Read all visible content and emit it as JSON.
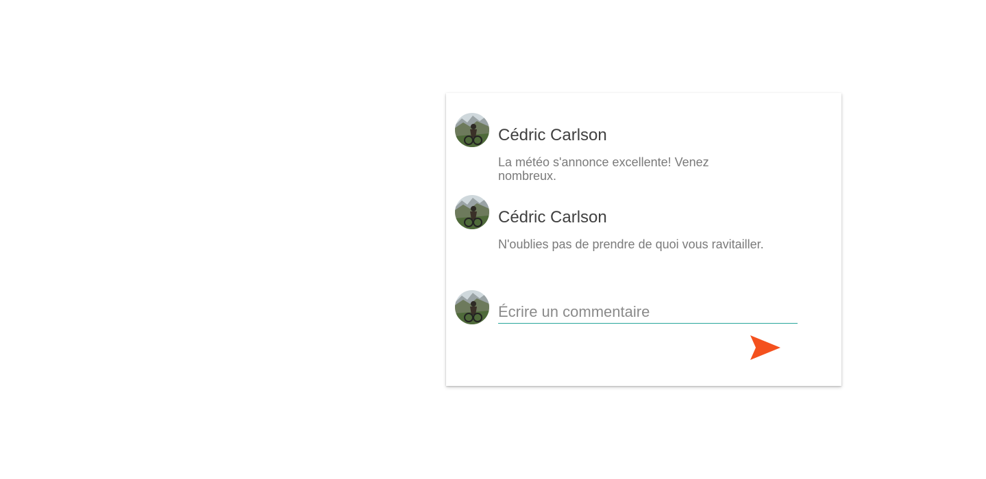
{
  "comments": [
    {
      "author": "Cédric Carlson",
      "text": "La météo s'annonce excellente! Venez nombreux."
    },
    {
      "author": "Cédric Carlson",
      "text": "N'oublies pas de prendre de quoi vous ravitailler."
    }
  ],
  "composer": {
    "placeholder": "Écrire un commentaire",
    "value": ""
  },
  "colors": {
    "send_icon": "#f4511e",
    "input_underline": "#26a69a",
    "author_text": "#404040",
    "body_text": "#7a7a7a"
  },
  "icons": {
    "send": "send-icon",
    "avatar": "avatar"
  }
}
